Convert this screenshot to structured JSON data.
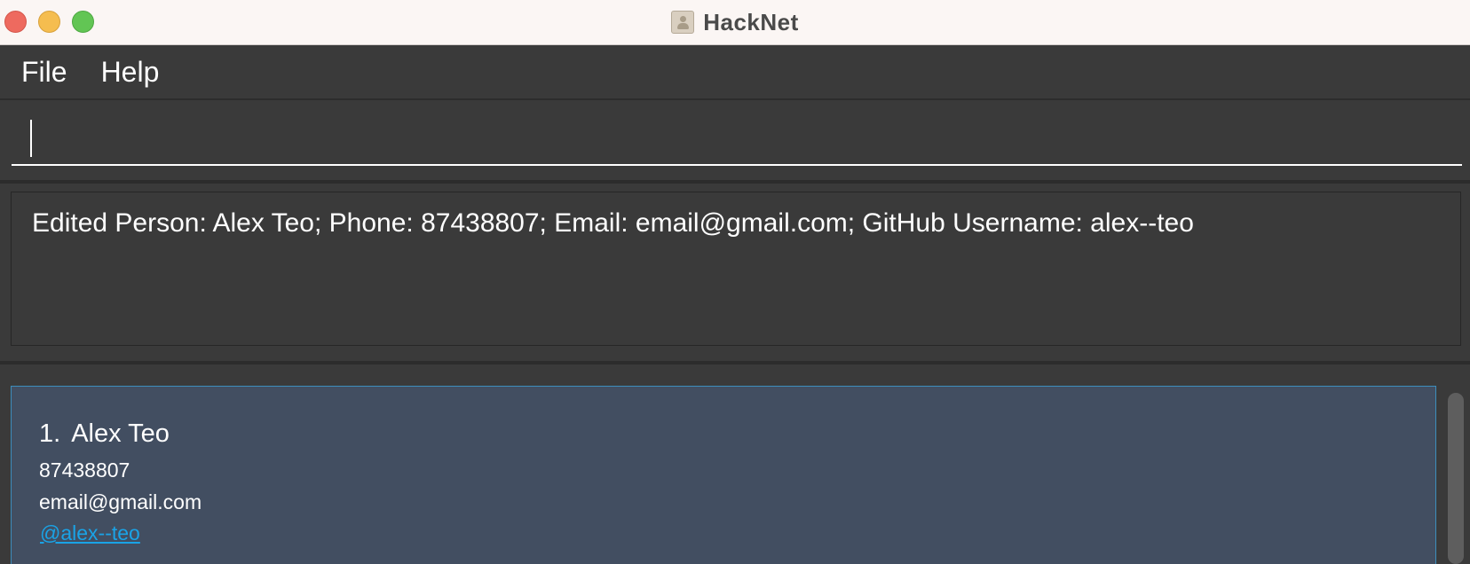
{
  "window": {
    "title": "HackNet",
    "icon": "contact-book-icon"
  },
  "menu": {
    "items": [
      {
        "label": "File"
      },
      {
        "label": "Help"
      }
    ]
  },
  "command": {
    "value": "",
    "placeholder": ""
  },
  "result": {
    "text": "Edited Person: Alex Teo; Phone: 87438807; Email: email@gmail.com; GitHub Username: alex--teo"
  },
  "persons": [
    {
      "index": "1.",
      "name": "Alex Teo",
      "phone": "87438807",
      "email": "email@gmail.com",
      "github": "@alex--teo"
    }
  ],
  "colors": {
    "background": "#3a3a3a",
    "card": "#424e61",
    "card_border": "#3d8ebd",
    "link": "#1aa3e6",
    "titlebar": "#fbf6f4"
  }
}
